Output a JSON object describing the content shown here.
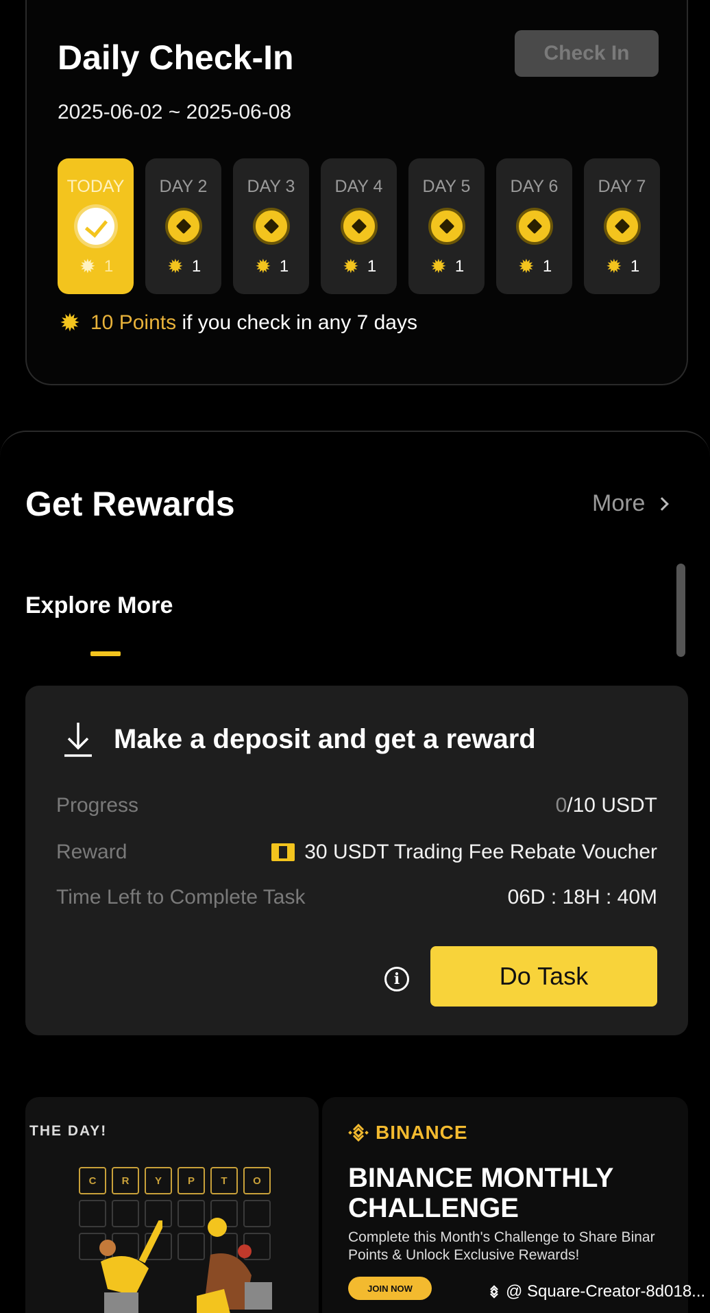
{
  "checkin": {
    "title": "Daily Check-In",
    "button_label": "Check In",
    "date_range": "2025-06-02 ~ 2025-06-08",
    "days": [
      {
        "label": "TODAY",
        "points": "1",
        "status": "checked"
      },
      {
        "label": "DAY 2",
        "points": "1",
        "status": "pending"
      },
      {
        "label": "DAY 3",
        "points": "1",
        "status": "pending"
      },
      {
        "label": "DAY 4",
        "points": "1",
        "status": "pending"
      },
      {
        "label": "DAY 5",
        "points": "1",
        "status": "pending"
      },
      {
        "label": "DAY 6",
        "points": "1",
        "status": "pending"
      },
      {
        "label": "DAY 7",
        "points": "1",
        "status": "pending"
      }
    ],
    "bonus_points": "10 Points",
    "bonus_text": "if you check in any 7 days"
  },
  "rewards": {
    "title": "Get Rewards",
    "more_label": "More",
    "tab_label": "Explore More"
  },
  "task": {
    "title": "Make a deposit and get a reward",
    "progress_label": "Progress",
    "progress_current": "0",
    "progress_total": "/10 USDT",
    "reward_label": "Reward",
    "reward_value": "30 USDT Trading Fee Rebate Voucher",
    "time_label": "Time Left to Complete Task",
    "time_value": "06D : 18H : 40M",
    "button_label": "Do Task"
  },
  "banner_left": {
    "heading": "THE DAY!",
    "letters": [
      "C",
      "R",
      "Y",
      "P",
      "T",
      "O"
    ]
  },
  "banner_right": {
    "brand": "BINANCE",
    "title_line1": "BINANCE MONTHLY",
    "title_line2": "CHALLENGE",
    "desc_line1": "Complete this Month's Challenge to Share Binar",
    "desc_line2": "Points & Unlock Exclusive Rewards!",
    "cta": "JOIN NOW"
  },
  "watermark": "@ Square-Creator-8d018...",
  "colors": {
    "accent": "#f3c41e",
    "brand": "#f3ba2f",
    "background": "#000000",
    "card": "#1e1e1e"
  }
}
